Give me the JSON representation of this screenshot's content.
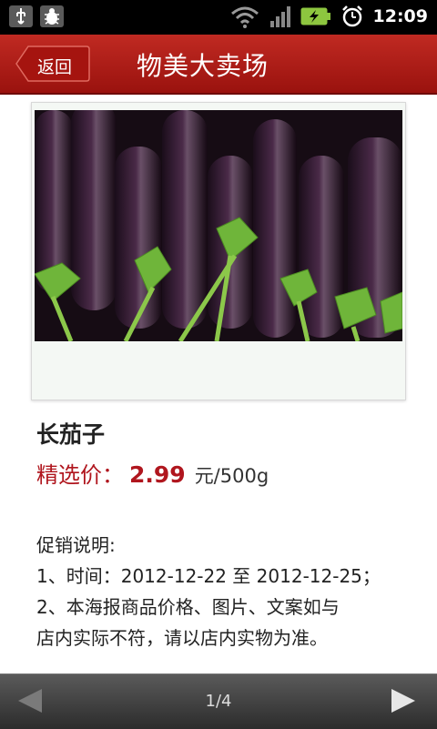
{
  "status_bar": {
    "time": "12:09",
    "icons": [
      "usb-icon",
      "debug-bug-icon",
      "wifi-icon",
      "signal-icon",
      "battery-charging-icon",
      "alarm-clock-icon"
    ]
  },
  "header": {
    "back_label": "返回",
    "title": "物美大卖场"
  },
  "product": {
    "image": "eggplant-photo",
    "name": "长茄子",
    "price_label": "精选价：",
    "price": "2.99",
    "unit": "元/500g"
  },
  "promo": {
    "heading": "促销说明:",
    "line1": "1、时间：2012-12-22 至 2012-12-25；",
    "line2a": "2、本海报商品价格、图片、文案如与",
    "line2b": "店内实际不符，请以店内实物为准。"
  },
  "pager": {
    "page": "1/4"
  },
  "colors": {
    "accent": "#b0161e",
    "header": "#a8160f"
  }
}
